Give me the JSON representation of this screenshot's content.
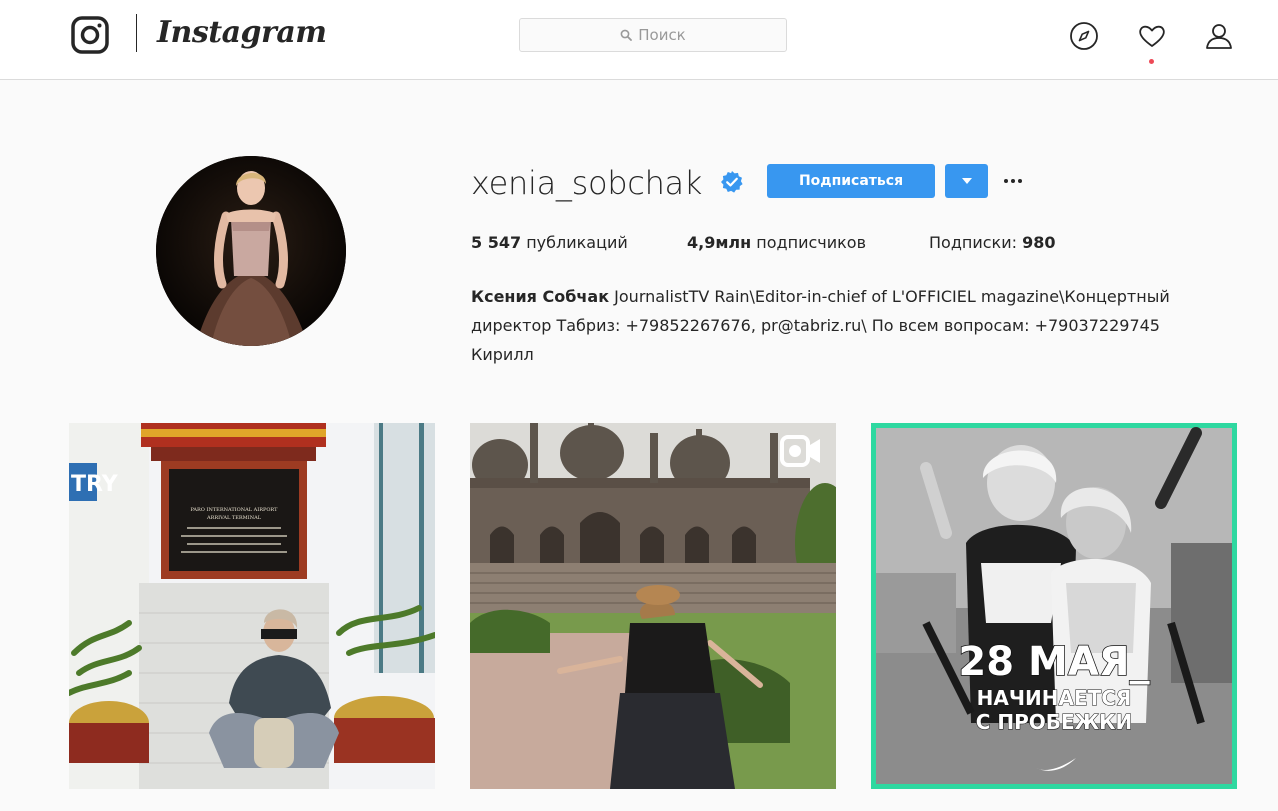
{
  "nav": {
    "wordmark": "Instagram",
    "search_placeholder": "Поиск",
    "icons": [
      "instagram-glyph-icon",
      "search-icon",
      "compass-icon",
      "heart-icon",
      "user-icon"
    ],
    "notification_dot_color": "#ed4956"
  },
  "profile": {
    "username": "xenia_sobchak",
    "verified": true,
    "follow_label": "Подписаться",
    "accent_color": "#3897f0",
    "stats": {
      "posts_count": "5 547",
      "posts_label": "публикаций",
      "followers_count": "4,9млн",
      "followers_label": "подписчиков",
      "following_label": "Подписки:",
      "following_count": "980"
    },
    "bio": {
      "name": "Ксения Собчак",
      "text_line1": "JournalistTV Rain\\Editor-in-chief of L'OFFICIEL magazine\\Концертный",
      "text_line2": "директор Табриз: +79852267676, pr@tabriz.ru\\ По всем вопросам: +79037229745",
      "text_line3": "Кирилл"
    }
  },
  "posts": [
    {
      "kind": "photo",
      "plaque_lines": [
        "PARO INTERNATIONAL AIRPORT",
        "ARRIVAL TERMINAL"
      ],
      "sign_fragment": "TRY"
    },
    {
      "kind": "video",
      "badge_icon": "video-icon"
    },
    {
      "kind": "photo",
      "overlay_line1": "28 МАЯ_",
      "overlay_line2": "НАЧИНАЕТСЯ",
      "overlay_line3": "С ПРОБЕЖКИ",
      "frame_color": "#2ed8a0"
    }
  ]
}
